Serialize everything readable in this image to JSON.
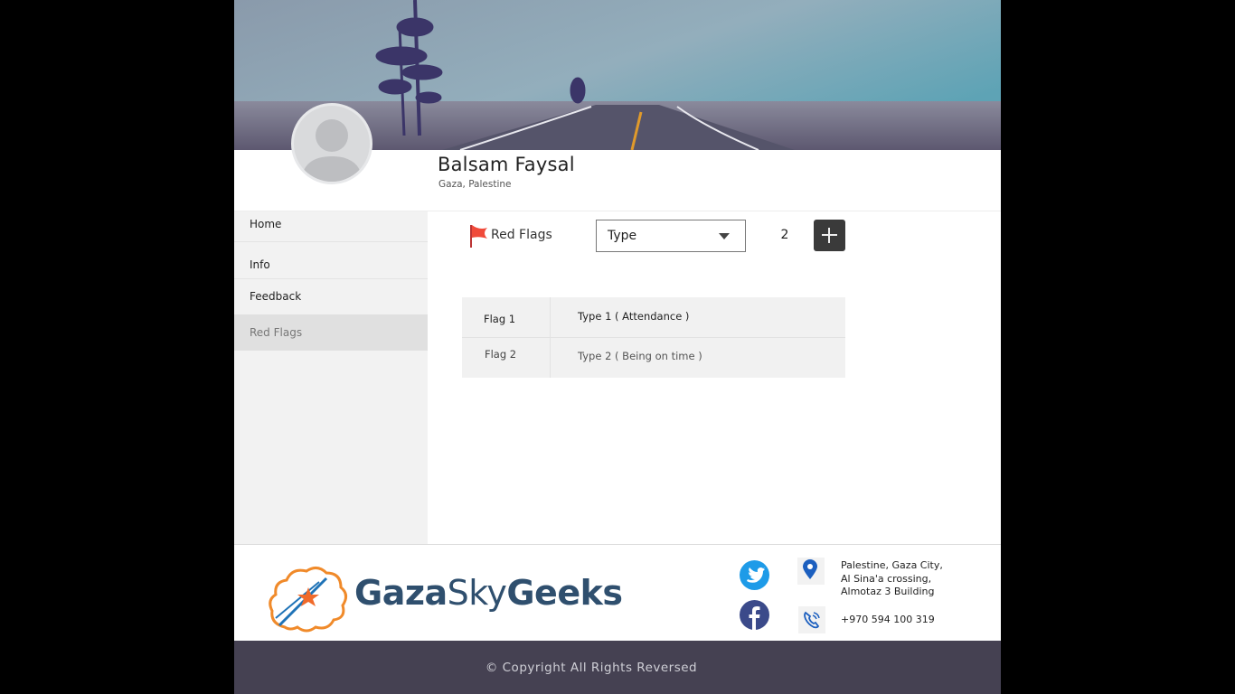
{
  "profile": {
    "name": "Balsam Faysal",
    "location": "Gaza, Palestine"
  },
  "sidebar": {
    "items": [
      {
        "label": "Home",
        "active": false
      },
      {
        "label": "Info",
        "active": false
      },
      {
        "label": "Feedback",
        "active": false
      },
      {
        "label": "Red Flags",
        "active": true
      }
    ]
  },
  "red_flags": {
    "title": "Red Flags",
    "type_select": {
      "selected": "Type"
    },
    "count": "2",
    "rows": [
      {
        "flag": "Flag 1",
        "type": "Type 1 ( Attendance )"
      },
      {
        "flag": "Flag 2",
        "type": "Type 2 ( Being on time )"
      }
    ]
  },
  "footer": {
    "brand": {
      "word1": "Gaza",
      "word2": "Sky",
      "word3": "Geeks"
    },
    "address_lines": [
      "Palestine, Gaza City,",
      "Al Sina'a crossing,",
      "Almotaz 3 Building"
    ],
    "phone": "+970 594 100 319",
    "copyright": "© Copyright All Rights Reversed"
  },
  "colors": {
    "accent_dark": "#3a3a3a",
    "flag_red": "#f04a3a",
    "brand_blue": "#2f4f6e",
    "twitter": "#1e9be8",
    "facebook": "#3b4a8a",
    "footer_bar": "#454152"
  },
  "icons": [
    "red-flag-icon",
    "caret-down-icon",
    "plus-icon",
    "twitter-icon",
    "facebook-icon",
    "location-pin-icon",
    "phone-icon",
    "avatar-placeholder-icon"
  ]
}
